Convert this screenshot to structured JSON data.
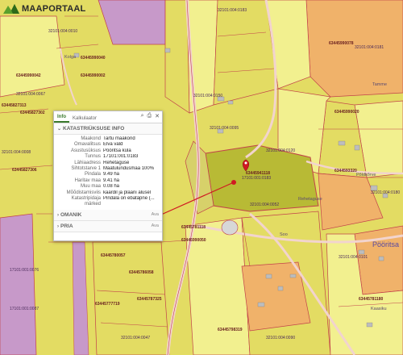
{
  "app": {
    "name": "MAAPORTAAL"
  },
  "popup": {
    "tabs": [
      {
        "label": "Info"
      },
      {
        "label": "Kalkulaator"
      }
    ],
    "section_title": "KATASTRIÜKSUSE INFO",
    "rows": [
      {
        "key": "Maakond",
        "value": "Tartu maakond"
      },
      {
        "key": "Omavalitsus",
        "value": "Elva vald"
      },
      {
        "key": "Asustusüksus",
        "value": "Pööritsa küla"
      },
      {
        "key": "Tunnus",
        "value": "17101:001:0183"
      },
      {
        "key": "Lähiaadress",
        "value": "Rehetaguse"
      },
      {
        "key": "Sihtotstarve 1",
        "value": "Maatulundusmaa 100%"
      },
      {
        "key": "Pindala",
        "value": "9.49 ha"
      },
      {
        "key": "Haritav maa",
        "value": "9.41 ha"
      },
      {
        "key": "Muu maa",
        "value": "0.08 ha"
      },
      {
        "key": "Mõõdistamisviis",
        "value": "kaardil ja plaani alusel"
      },
      {
        "key": "Katastripidaja märked",
        "value": "Pindala on ebatäpne (..."
      }
    ],
    "sections": [
      {
        "title": "OMANIK",
        "action": "Ava"
      },
      {
        "title": "PRIA",
        "action": "Ava"
      }
    ]
  },
  "map": {
    "places": [
      {
        "name": "Pööritsa",
        "size": "large"
      },
      {
        "name": "Rehetaguse",
        "size": "small"
      },
      {
        "name": "Kolga",
        "size": "small"
      },
      {
        "name": "Tamme",
        "size": "small"
      },
      {
        "name": "Soo",
        "size": "small"
      },
      {
        "name": "Põldkõrve",
        "size": "small"
      },
      {
        "name": "Kaasiku",
        "size": "small"
      }
    ],
    "plot_ids": [
      "63445990078",
      "63445990042",
      "63445990040",
      "63445990002",
      "63445827313",
      "63445941118",
      "63445827302",
      "63445827306",
      "63445990020",
      "6344593320",
      "63445781118",
      "63445990050",
      "63445780057",
      "63445786058",
      "63445787325",
      "63445777719",
      "63445781180",
      "63445798319"
    ],
    "cadastral_ids": [
      "17101:001:0183",
      "32101:004:0183",
      "32101:004:0067",
      "32101:004:0008",
      "17101:001:0076",
      "17101:001:0087",
      "32101:004:0095",
      "32101:004:0120",
      "32101:004:0150",
      "32101:004:0180",
      "32101:004:0101",
      "32101:004:0052",
      "32101:004:0090",
      "32101:004:0181",
      "32101:004:0047",
      "32101:004:0010"
    ]
  },
  "colors": {
    "field": "#e3dc63",
    "selected_parcel": "#b8ba35",
    "forest_yellow": "#f2f08f",
    "residential_orange": "#f0b26a",
    "purple": "#c799c9",
    "boundary": "#c2414a",
    "road": "#f2d4ce",
    "accent": "#3a7a2c",
    "marker": "#d01a22"
  }
}
